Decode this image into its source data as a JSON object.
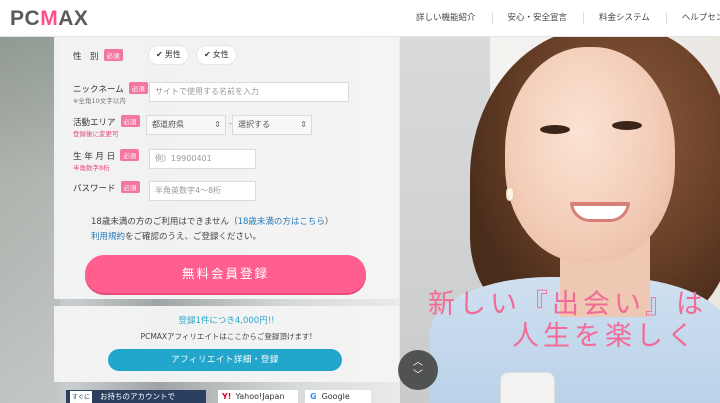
{
  "header": {
    "logo_text_a": "PC",
    "logo_text_b": "M",
    "logo_text_c": "AX",
    "nav": [
      {
        "label": "詳しい機能紹介"
      },
      {
        "label": "安心・安全宣言"
      },
      {
        "label": "料金システム"
      },
      {
        "label": "ヘルプセンタ"
      }
    ]
  },
  "form": {
    "required_badge": "必須",
    "gender": {
      "label": "性　別",
      "options": [
        "男性",
        "女性"
      ]
    },
    "nickname": {
      "label": "ニックネーム",
      "note": "※全角10文字以内",
      "placeholder": "サイトで使用する名前を入力"
    },
    "area": {
      "label": "活動エリア",
      "note": "登録後に変更可",
      "prefecture": "都道府県",
      "dash": "-",
      "city": "選択する"
    },
    "birthday": {
      "label": "生 年 月 日",
      "note": "半角数字8桁",
      "placeholder": "例）19900401"
    },
    "password": {
      "label": "パスワード",
      "placeholder": "半角英数字4～8桁"
    },
    "notice_prefix": "18歳未満の方のご利用はできません（",
    "notice_link": "18歳未満の方はこちら",
    "notice_suffix": "）",
    "terms_link": "利用規約",
    "terms_suffix": "をご確認のうえ、ご登録ください。",
    "submit_label": "無料会員登録"
  },
  "affiliate": {
    "title": "登録1件につき4,000円!!",
    "subtitle": "PCMAXアフィリエイトはここからご登録頂けます!",
    "button_label": "アフィリエイト詳細・登録"
  },
  "social": {
    "badge": "すぐに",
    "account_label": "お持ちのアカウントで",
    "yahoo_label": "Yahoo!Japan",
    "google_label": "Google"
  },
  "hero": {
    "tagline_line1": "新しい『出会い』は",
    "tagline_line2": "人生を楽しく"
  },
  "scroll": {
    "up": "︿",
    "down": "﹀"
  },
  "colors": {
    "accent_pink": "#ff5e8e",
    "accent_blue": "#22a6cb"
  }
}
